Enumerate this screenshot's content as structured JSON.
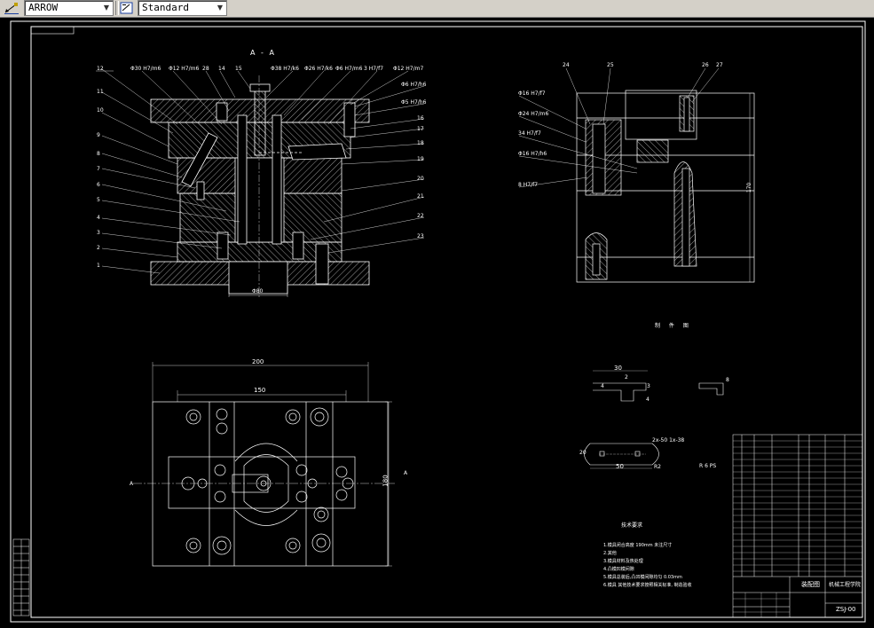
{
  "toolbar": {
    "arrow_style": "ARROW",
    "text_style": "Standard",
    "icons": [
      "dimension-style-icon",
      "text-style-icon"
    ]
  },
  "drawing": {
    "section_title": "A - A",
    "left_callouts": [
      "12",
      "11",
      "10",
      "9",
      "8",
      "7",
      "6",
      "5",
      "4",
      "3",
      "2",
      "1"
    ],
    "top_callouts": [
      "Φ30 H7/m6",
      "Φ12 H7/m6",
      "28",
      "14",
      "15",
      "Φ38 H7/k6",
      "Φ26 H7/k6",
      "Φ6 H7/m6",
      "3 H7/f7",
      "Φ12 H7/m7"
    ],
    "right_callouts": [
      "Φ6 H7/h6",
      "Φ5 H7/h6",
      "16",
      "17",
      "18",
      "19",
      "20",
      "21",
      "22",
      "23"
    ],
    "bottom_dim": "Φ80",
    "side_view_top": [
      "24",
      "25",
      "26",
      "27"
    ],
    "side_view_fits": [
      "Φ16 H7/f7",
      "Φ24 H7/m6",
      "34 H7/f7",
      "Φ16 H7/h6",
      "8 H7/f7"
    ],
    "side_view_height": "170",
    "plan_dims": {
      "overall_width": "200",
      "inner_width": "150",
      "height": "180",
      "section_mark_left": "A",
      "section_mark_right": "A"
    },
    "part_label_top": "制 件 图",
    "part_dims": {
      "d30": "30",
      "d2": "2",
      "d4a": "4",
      "d4b": "4",
      "d3": "3",
      "d8": "8",
      "d50": "50",
      "d20": "20",
      "r2": "R2",
      "chamfer": "2x-50 1x-38"
    },
    "part_spec": "R  6  PS",
    "notes_title": "技术要求",
    "notes": [
      "1.模具闭合高度   190mm 未注尺寸",
      "2.其他",
      "3.模具材料及热处理",
      "4.凸模凹模间隙",
      "5.模具总装后,凸凹模间隙均匀 0.03mm",
      "6.模具 其他技术要求按照相关标准, 制造验收"
    ],
    "title_block": {
      "drawing_name": "装配图",
      "school": "机械工程学院",
      "code": "ZSJ-00",
      "rows": 22
    }
  }
}
